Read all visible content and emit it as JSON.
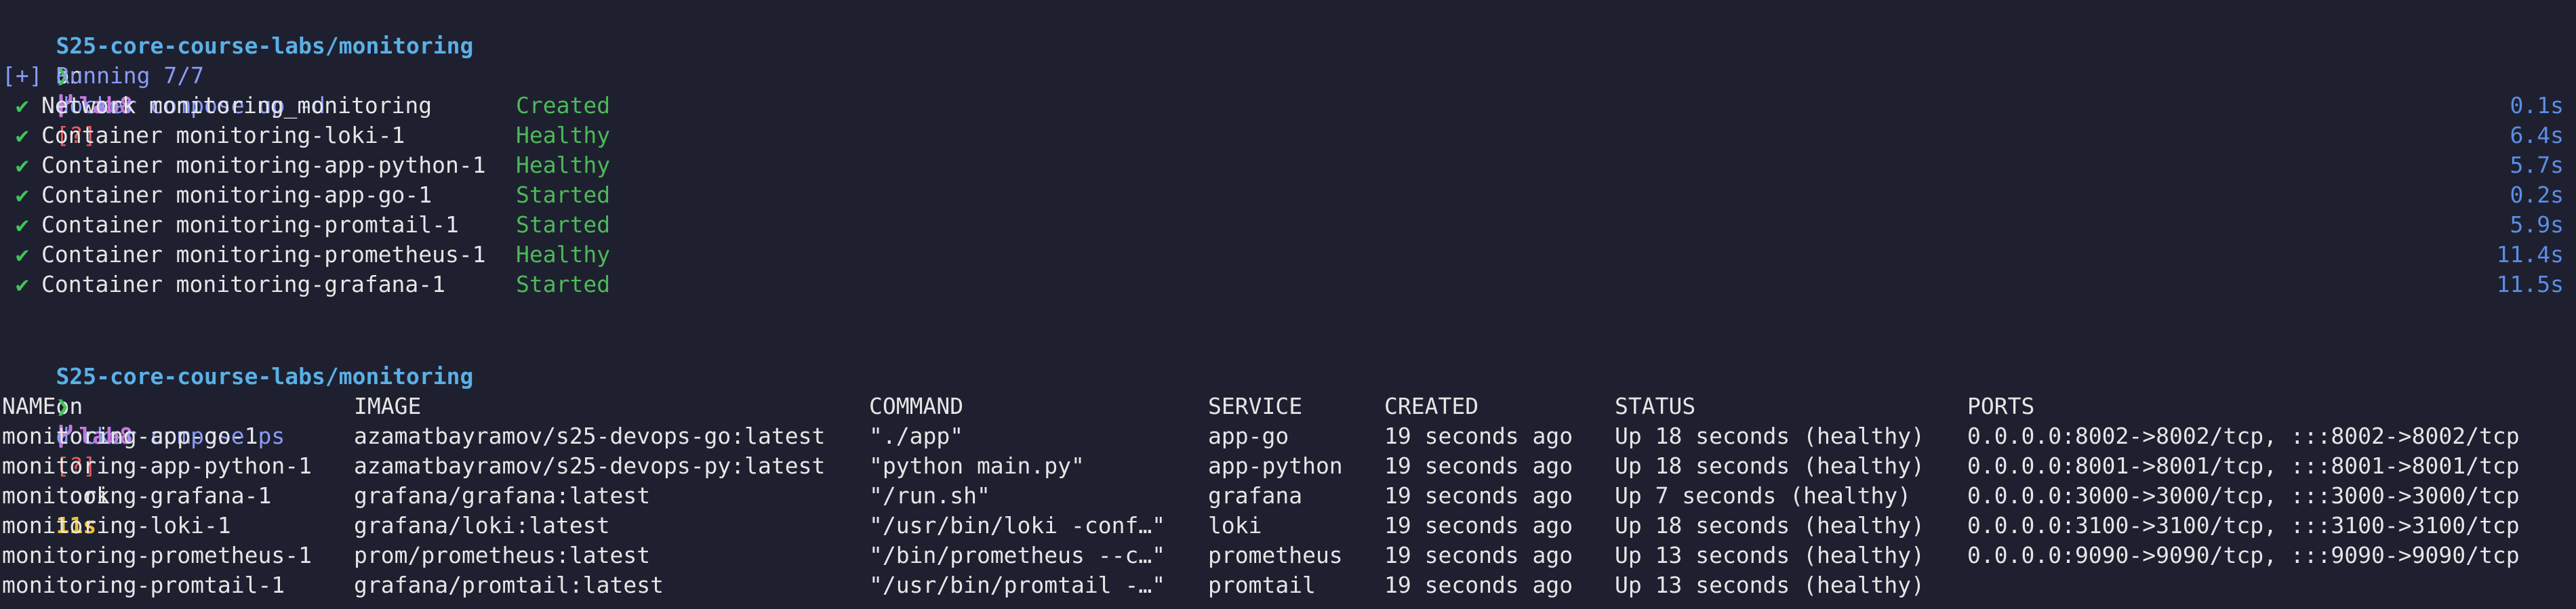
{
  "prompt1": {
    "path": "S25-core-course-labs/monitoring",
    "on": "on",
    "branch": "lab8",
    "status": "[?]"
  },
  "cmd1": {
    "arrow": "❯",
    "text": "docker compose up -d"
  },
  "running": "[+] Running 7/7",
  "resources": [
    {
      "check": "✔",
      "name": "Network monitoring_monitoring",
      "state": "Created",
      "time": "0.1s"
    },
    {
      "check": "✔",
      "name": "Container monitoring-loki-1",
      "state": "Healthy",
      "time": "6.4s"
    },
    {
      "check": "✔",
      "name": "Container monitoring-app-python-1",
      "state": "Healthy",
      "time": "5.7s"
    },
    {
      "check": "✔",
      "name": "Container monitoring-app-go-1",
      "state": "Started",
      "time": "0.2s"
    },
    {
      "check": "✔",
      "name": "Container monitoring-promtail-1",
      "state": "Started",
      "time": "5.9s"
    },
    {
      "check": "✔",
      "name": "Container monitoring-prometheus-1",
      "state": "Healthy",
      "time": "11.4s"
    },
    {
      "check": "✔",
      "name": "Container monitoring-grafana-1",
      "state": "Started",
      "time": "11.5s"
    }
  ],
  "prompt2": {
    "path": "S25-core-course-labs/monitoring",
    "on": "on",
    "branch": "lab8",
    "status": "[?]",
    "took_label": "took",
    "took_value": "11s"
  },
  "cmd2": {
    "arrow": "❯",
    "text": "docker compose ps"
  },
  "ps": {
    "headers": [
      "NAME",
      "IMAGE",
      "COMMAND",
      "SERVICE",
      "CREATED",
      "STATUS",
      "PORTS"
    ],
    "rows": [
      [
        "monitoring-app-go-1",
        "azamatbayramov/s25-devops-go:latest",
        "\"./app\"",
        "app-go",
        "19 seconds ago",
        "Up 18 seconds (healthy)",
        "0.0.0.0:8002->8002/tcp, :::8002->8002/tcp"
      ],
      [
        "monitoring-app-python-1",
        "azamatbayramov/s25-devops-py:latest",
        "\"python main.py\"",
        "app-python",
        "19 seconds ago",
        "Up 18 seconds (healthy)",
        "0.0.0.0:8001->8001/tcp, :::8001->8001/tcp"
      ],
      [
        "monitoring-grafana-1",
        "grafana/grafana:latest",
        "\"/run.sh\"",
        "grafana",
        "19 seconds ago",
        "Up 7 seconds (healthy)",
        "0.0.0.0:3000->3000/tcp, :::3000->3000/tcp"
      ],
      [
        "monitoring-loki-1",
        "grafana/loki:latest",
        "\"/usr/bin/loki -conf…\"",
        "loki",
        "19 seconds ago",
        "Up 18 seconds (healthy)",
        "0.0.0.0:3100->3100/tcp, :::3100->3100/tcp"
      ],
      [
        "monitoring-prometheus-1",
        "prom/prometheus:latest",
        "\"/bin/prometheus --c…\"",
        "prometheus",
        "19 seconds ago",
        "Up 13 seconds (healthy)",
        "0.0.0.0:9090->9090/tcp, :::9090->9090/tcp"
      ],
      [
        "monitoring-promtail-1",
        "grafana/promtail:latest",
        "\"/usr/bin/promtail -…\"",
        "promtail",
        "19 seconds ago",
        "Up 13 seconds (healthy)",
        ""
      ]
    ]
  }
}
